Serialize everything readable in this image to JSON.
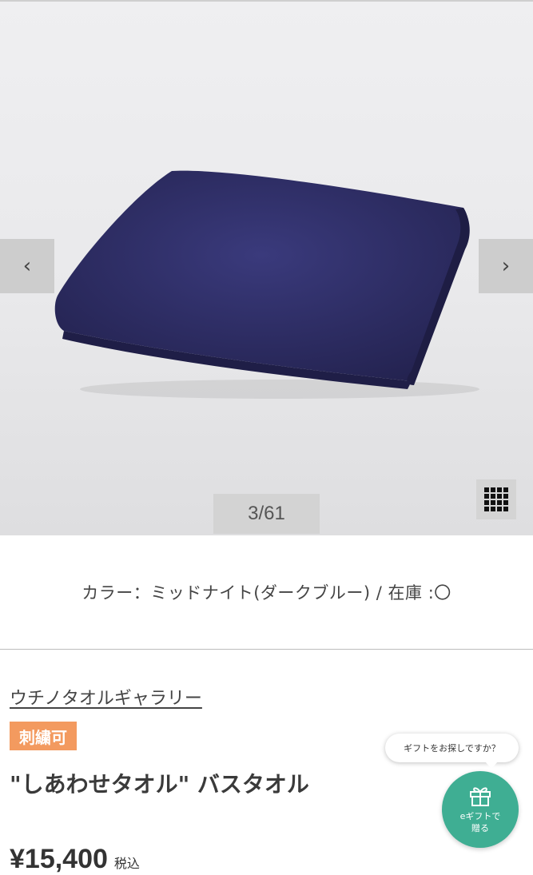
{
  "gallery": {
    "prev_glyph": "‹",
    "next_glyph": "›",
    "counter": "3/61",
    "grid_icon": "grid-icon",
    "product_color": "#2b2a62"
  },
  "product": {
    "color_line": "カラー：ミッドナイト(ダークブルー) / 在庫 :〇",
    "brand": "ウチノタオルギャラリー",
    "badge": "刺繍可",
    "title": "\"しあわせタオル\" バスタオル",
    "price": "¥15,400",
    "tax_label": "税込"
  },
  "gift": {
    "bubble_text": "ギフトをお探しですか？",
    "button_label": "eギフトで\n贈る",
    "icon": "gift-icon",
    "accent": "#3fae93"
  },
  "colors": {
    "badge_bg": "#f39a5f"
  }
}
